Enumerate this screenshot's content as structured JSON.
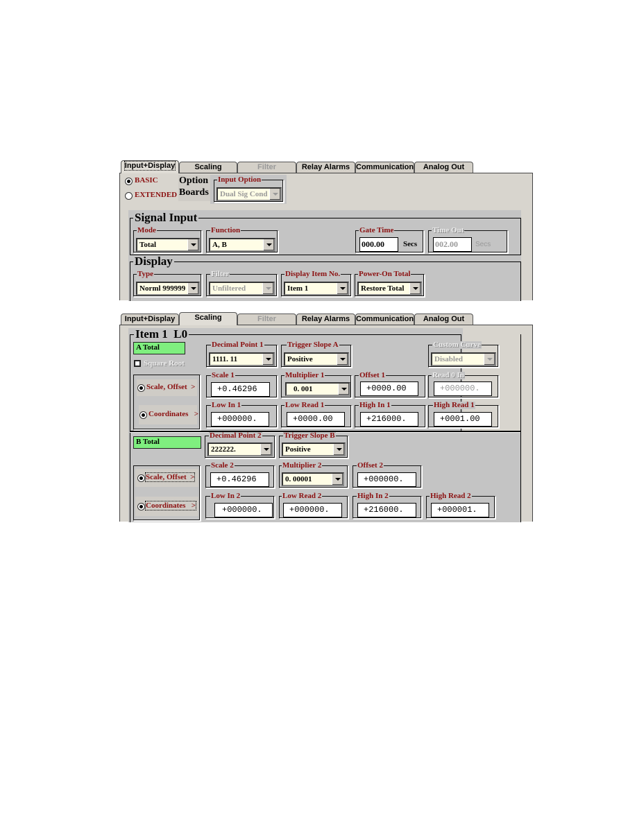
{
  "tabs": [
    {
      "label": "Input+Display",
      "state": "normal"
    },
    {
      "label": "Scaling",
      "state": "normal"
    },
    {
      "label": "Filter",
      "state": "disabled"
    },
    {
      "label": "Relay Alarms",
      "state": "normal"
    },
    {
      "label": "Communication",
      "state": "normal"
    },
    {
      "label": "Analog Out",
      "state": "normal"
    }
  ],
  "screen1": {
    "active_tab": "Input+Display",
    "mode_basic": "BASIC",
    "mode_extended": "EXTENDED",
    "option_boards_line1": "Option",
    "option_boards_line2": "Boards",
    "input_option": {
      "label": "Input Option",
      "value": "Dual Sig Cond"
    },
    "signal_input": {
      "title": "Signal Input",
      "mode": {
        "label": "Mode",
        "value": "Total"
      },
      "function": {
        "label": "Function",
        "value": "A, B"
      },
      "gate_time": {
        "label": "Gate Time",
        "value": "000.00",
        "unit": "Secs"
      },
      "time_out": {
        "label": "Time Out",
        "value": "002.00",
        "unit": "Secs"
      }
    },
    "display": {
      "title": "Display",
      "type": {
        "label": "Type",
        "value": "Norml 999999"
      },
      "filter": {
        "label": "Filter",
        "value": "Unfiltered"
      },
      "display_item": {
        "label": "Display Item No.",
        "value": "Item 1"
      },
      "power_on_total": {
        "label": "Power-On Total",
        "value": "Restore Total"
      }
    }
  },
  "screen2": {
    "active_tab": "Scaling",
    "group_title": "Item 1  L0",
    "a": {
      "name": "A Total",
      "square_root": "Square Root",
      "decimal_point": {
        "label": "Decimal Point 1",
        "value": "1111. 11"
      },
      "trigger_slope": {
        "label": "Trigger Slope A",
        "value": "Positive"
      },
      "custom_curve": {
        "label": "Custom Curve",
        "value": "Disabled"
      },
      "scale_offset": "Scale, Offset  >",
      "coordinates": "Coordinates   >",
      "scale": {
        "label": "Scale 1",
        "value": "+0.46296"
      },
      "multiplier": {
        "label": "Multiplier 1",
        "value": "0. 001"
      },
      "offset": {
        "label": "Offset 1",
        "value": "+0000.00"
      },
      "read0in": {
        "label": "Read 0 In",
        "value": "+000000."
      },
      "low_in": {
        "label": "Low In 1",
        "value": "+000000."
      },
      "low_read": {
        "label": "Low Read 1",
        "value": "+0000.00"
      },
      "high_in": {
        "label": "High In 1",
        "value": "+216000."
      },
      "high_read": {
        "label": "High Read 1",
        "value": "+0001.00"
      }
    },
    "b": {
      "name": "B Total",
      "decimal_point": {
        "label": "Decimal Point 2",
        "value": "222222."
      },
      "trigger_slope": {
        "label": "Trigger Slope B",
        "value": "Positive"
      },
      "scale_offset": "Scale, Offset  >",
      "coordinates": "Coordinates   >",
      "scale": {
        "label": "Scale 2",
        "value": "+0.46296"
      },
      "multiplier": {
        "label": "Multiplier 2",
        "value": "0. 00001"
      },
      "offset": {
        "label": "Offset 2",
        "value": "+000000."
      },
      "low_in": {
        "label": "Low In 2",
        "value": "+000000."
      },
      "low_read": {
        "label": "Low Read 2",
        "value": "+000000."
      },
      "high_in": {
        "label": "High In 2",
        "value": "+216000."
      },
      "high_read": {
        "label": "High Read 2",
        "value": "+000001."
      }
    }
  }
}
